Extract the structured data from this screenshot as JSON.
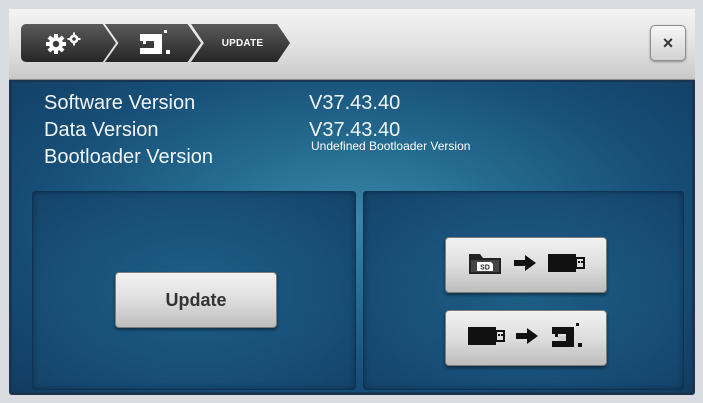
{
  "breadcrumb": {
    "items": [
      {
        "icon": "gears-icon"
      },
      {
        "icon": "sewing-machine-icon"
      },
      {
        "label": "UPDATE"
      }
    ]
  },
  "close_button": {
    "icon": "close-icon",
    "label": "×"
  },
  "version_info": {
    "software": {
      "label": "Software Version",
      "value": "V37.43.40"
    },
    "data": {
      "label": "Data Version",
      "value": "V37.43.40"
    },
    "bootloader": {
      "label": "Bootloader Version",
      "value": "Undefined Bootloader Version"
    }
  },
  "update_panel": {
    "button_label": "Update"
  },
  "transfer_panel": {
    "buttons": [
      {
        "icons": [
          "sd-card-folder-icon",
          "arrow-right-icon",
          "usb-stick-icon"
        ]
      },
      {
        "icons": [
          "usb-stick-icon",
          "arrow-right-icon",
          "sewing-machine-icon"
        ]
      }
    ]
  },
  "colors": {
    "topbar": "#e1e1e1",
    "crumb": "#2e2e2e",
    "content_blue": "#1f5f88",
    "button": "#dedede"
  }
}
